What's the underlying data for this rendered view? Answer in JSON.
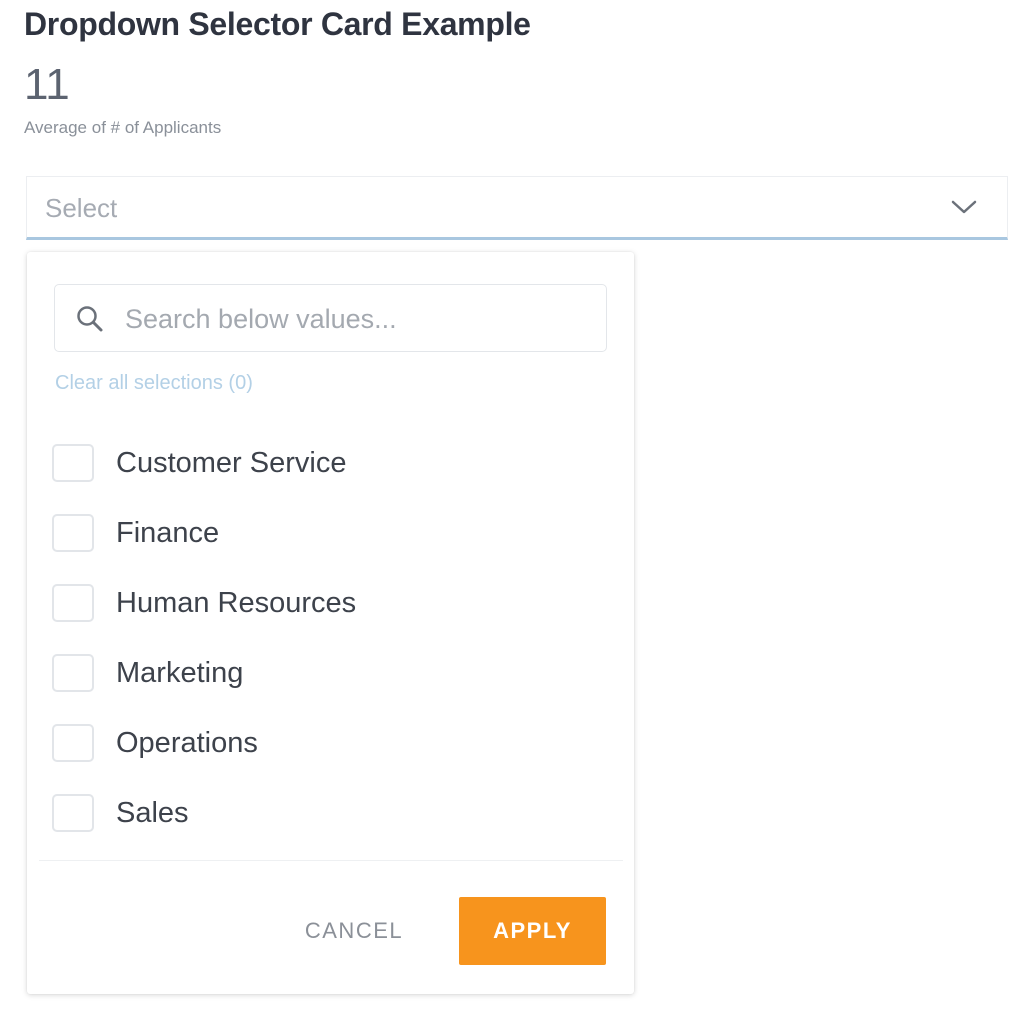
{
  "card": {
    "title": "Dropdown Selector Card Example",
    "metric_value": "11",
    "metric_label": "Average of # of Applicants"
  },
  "select": {
    "placeholder": "Select",
    "chevron_icon": "chevron-down-icon"
  },
  "dropdown": {
    "search": {
      "icon": "search-icon",
      "placeholder": "Search below values...",
      "value": ""
    },
    "clear_label": "Clear all selections (0)",
    "options": [
      {
        "label": "Customer Service",
        "checked": false
      },
      {
        "label": "Finance",
        "checked": false
      },
      {
        "label": "Human Resources",
        "checked": false
      },
      {
        "label": "Marketing",
        "checked": false
      },
      {
        "label": "Operations",
        "checked": false
      },
      {
        "label": "Sales",
        "checked": false
      }
    ],
    "cancel_label": "CANCEL",
    "apply_label": "APPLY"
  },
  "colors": {
    "accent": "#f7941d",
    "link": "#b3d0e6",
    "focus_underline": "#a9c7e0"
  }
}
